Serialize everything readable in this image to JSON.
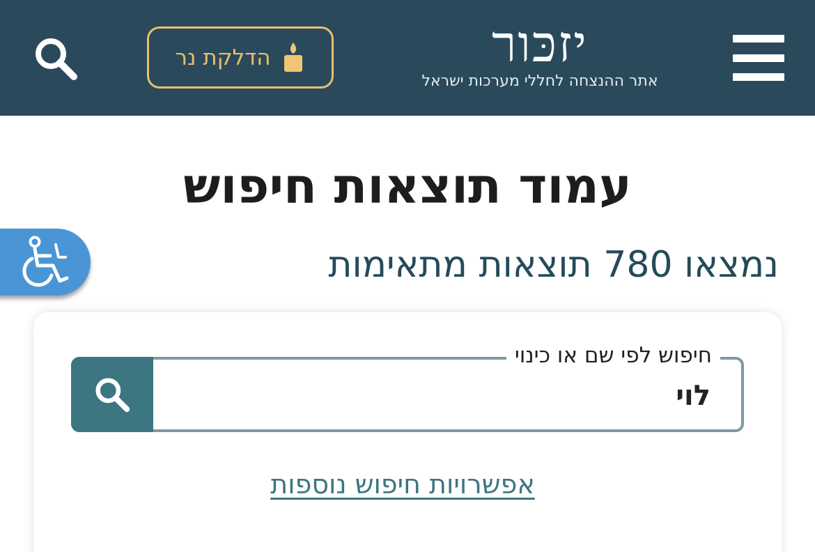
{
  "header": {
    "logo_title": "יזכּור",
    "logo_subtitle": "אתר ההנצחה לחללי מערכות ישראל",
    "candle_button_label": "הדלקת נר",
    "menu_icon": "hamburger-menu-icon",
    "search_icon": "search-icon",
    "candle_icon": "candle-icon"
  },
  "main": {
    "page_title": "עמוד תוצאות חיפוש",
    "results_count_text": "נמצאו 780 תוצאות מתאימות"
  },
  "search": {
    "field_label": "חיפוש לפי שם או כינוי",
    "field_value": "לוי",
    "more_options_link": "אפשרויות חיפוש נוספות"
  },
  "accessibility": {
    "icon": "wheelchair-icon"
  },
  "colors": {
    "header_bg": "#2a4a5c",
    "accent_gold": "#e9c06c",
    "teal": "#3b7681",
    "results_text": "#244b59",
    "accessibility_blue": "#4a95d6"
  }
}
